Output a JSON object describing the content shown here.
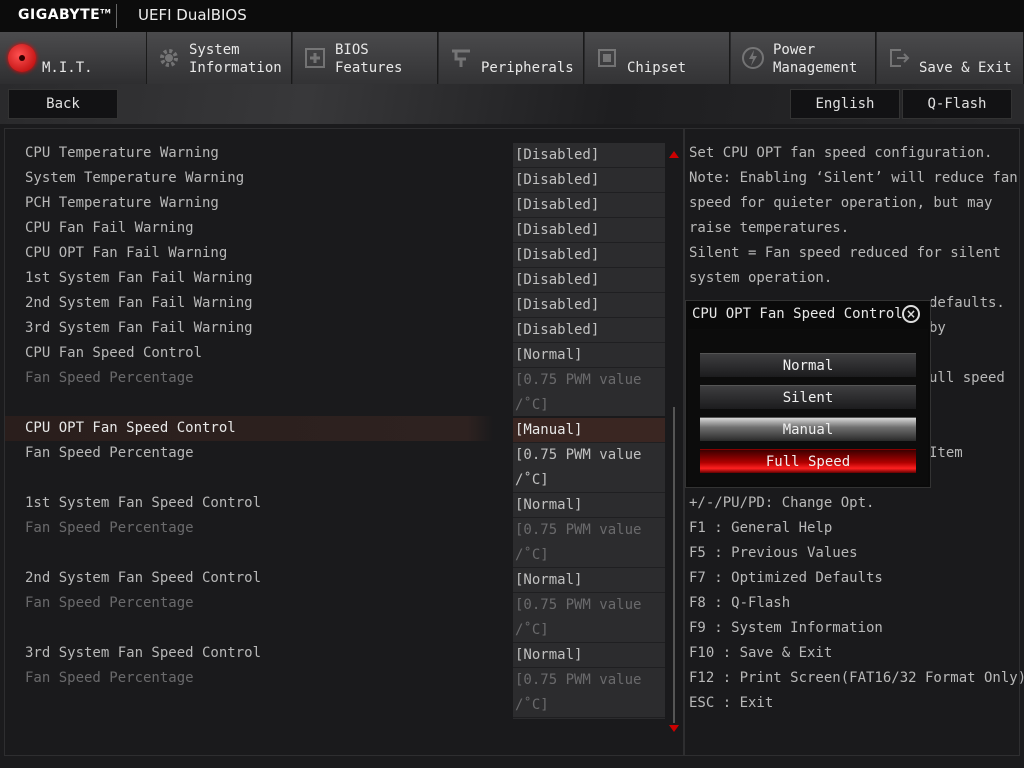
{
  "brand": "GIGABYTE",
  "brand_tm": "TM",
  "bios_title": "UEFI DualBIOS",
  "tabs": [
    {
      "line1": "",
      "line2": "M.I.T.",
      "icon": "mit-icon"
    },
    {
      "line1": "System",
      "line2": "Information",
      "icon": "gear-icon"
    },
    {
      "line1": "BIOS",
      "line2": "Features",
      "icon": "bios-features-icon"
    },
    {
      "line1": "",
      "line2": "Peripherals",
      "icon": "peripherals-icon"
    },
    {
      "line1": "",
      "line2": "Chipset",
      "icon": "chipset-icon"
    },
    {
      "line1": "Power",
      "line2": "Management",
      "icon": "power-icon"
    },
    {
      "line1": "",
      "line2": "Save & Exit",
      "icon": "exit-icon"
    }
  ],
  "subbar": {
    "back": "Back",
    "language": "English",
    "qflash": "Q-Flash"
  },
  "settings": [
    {
      "name": "CPU Temperature Warning",
      "value": "[Disabled]"
    },
    {
      "name": "System Temperature Warning",
      "value": "[Disabled]"
    },
    {
      "name": "PCH Temperature Warning",
      "value": "[Disabled]"
    },
    {
      "name": "CPU Fan Fail Warning",
      "value": "[Disabled]"
    },
    {
      "name": "CPU OPT Fan Fail Warning",
      "value": "[Disabled]"
    },
    {
      "name": "1st System Fan Fail Warning",
      "value": "[Disabled]"
    },
    {
      "name": "2nd System Fan Fail Warning",
      "value": "[Disabled]"
    },
    {
      "name": "3rd System Fan Fail Warning",
      "value": "[Disabled]"
    },
    {
      "name": "CPU Fan Speed Control",
      "value": "[Normal]"
    },
    {
      "name": "Fan Speed Percentage",
      "value1": "[0.75 PWM value",
      "value2": "/˚C]"
    },
    {
      "name": "CPU OPT Fan Speed Control",
      "value": "[Manual]"
    },
    {
      "name": "Fan Speed Percentage",
      "value1": "[0.75 PWM value",
      "value2": "/˚C]"
    },
    {
      "name": "1st System Fan Speed Control",
      "value": "[Normal]"
    },
    {
      "name": "Fan Speed Percentage",
      "value1": "[0.75 PWM value",
      "value2": "/˚C]"
    },
    {
      "name": "2nd System Fan Speed Control",
      "value": "[Normal]"
    },
    {
      "name": "Fan Speed Percentage",
      "value1": "[0.75 PWM value",
      "value2": "/˚C]"
    },
    {
      "name": "3rd System Fan Speed Control",
      "value": "[Normal]"
    },
    {
      "name": "Fan Speed Percentage",
      "value1": "[0.75 PWM value",
      "value2": "/˚C]"
    }
  ],
  "help": {
    "lines": [
      "Set CPU OPT fan speed configuration.",
      "Note: Enabling ‘Silent’ will reduce fan",
      "speed for quieter operation, but may",
      "raise temperatures.",
      "Silent = Fan speed reduced for silent",
      "system operation.",
      "defaults.",
      "by",
      "ull speed",
      "Item"
    ],
    "keys": [
      "+/-/PU/PD: Change Opt.",
      "F1  : General Help",
      "F5  : Previous Values",
      "F7  : Optimized Defaults",
      "F8  : Q-Flash",
      "F9  : System Information",
      "F10 : Save & Exit",
      "F12 : Print Screen(FAT16/32 Format Only)",
      "ESC : Exit"
    ]
  },
  "popup": {
    "title": "CPU OPT Fan Speed Control",
    "close": "×",
    "options": [
      "Normal",
      "Silent",
      "Manual",
      "Full Speed"
    ],
    "selected": "Manual",
    "highlighted": "Full Speed"
  },
  "colors": {
    "accent": "#cc0000",
    "selected_row": "#3a2622"
  }
}
